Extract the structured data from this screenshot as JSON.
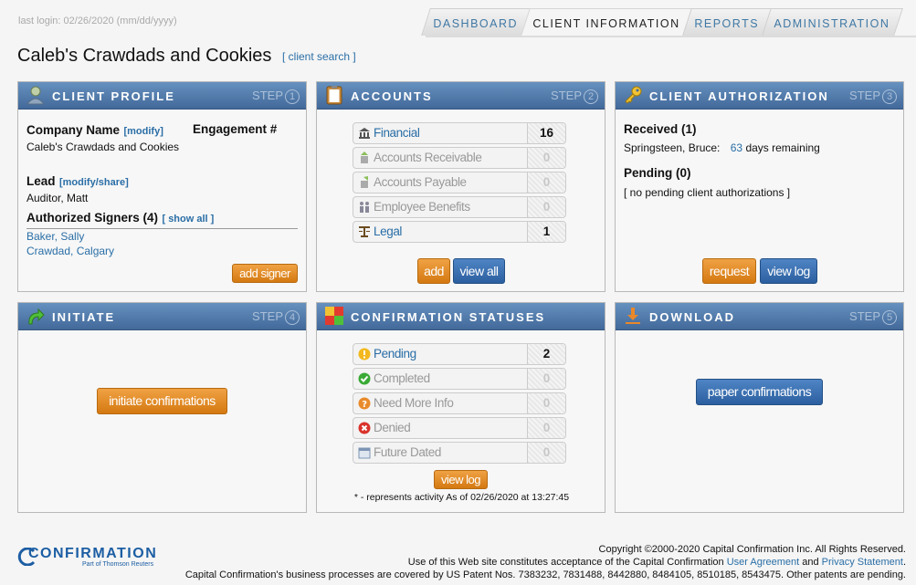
{
  "header": {
    "last_login": "last login: 02/26/2020 (mm/dd/yyyy)",
    "tabs": [
      "DASHBOARD",
      "CLIENT INFORMATION",
      "REPORTS",
      "ADMINISTRATION"
    ],
    "active_tab": "CLIENT INFORMATION"
  },
  "page": {
    "title": "Caleb's Crawdads and Cookies",
    "client_search": "[ client search ]"
  },
  "profile": {
    "title": "CLIENT PROFILE",
    "step_word": "STEP",
    "step_num": "1",
    "company_label": "Company Name",
    "company_link": "[modify]",
    "company_value": "Caleb's Crawdads and Cookies",
    "engagement_label": "Engagement #",
    "lead_label": "Lead",
    "lead_link": "[modify/share]",
    "lead_value": "Auditor, Matt",
    "signers_label": "Authorized Signers (4)",
    "signers_link": "[ show all ]",
    "signers": [
      "Baker, Sally",
      "Crawdad, Calgary"
    ],
    "add_signer": "add signer"
  },
  "accounts": {
    "title": "ACCOUNTS",
    "step_word": "STEP",
    "step_num": "2",
    "items": [
      {
        "label": "Financial",
        "count": "16",
        "active": true
      },
      {
        "label": "Accounts Receivable",
        "count": "0",
        "active": false
      },
      {
        "label": "Accounts Payable",
        "count": "0",
        "active": false
      },
      {
        "label": "Employee Benefits",
        "count": "0",
        "active": false
      },
      {
        "label": "Legal",
        "count": "1",
        "active": true
      }
    ],
    "add": "add",
    "view_all": "view all"
  },
  "authorization": {
    "title": "CLIENT AUTHORIZATION",
    "step_word": "STEP",
    "step_num": "3",
    "received_label": "Received (1)",
    "received_name": "Springsteen, Bruce:",
    "received_days": "63",
    "received_suffix": "days remaining",
    "pending_label": "Pending (0)",
    "pending_text": "[ no pending client authorizations ]",
    "request": "request",
    "view_log": "view log"
  },
  "initiate": {
    "title": "INITIATE",
    "step_word": "STEP",
    "step_num": "4",
    "button": "initiate confirmations"
  },
  "statuses": {
    "title": "CONFIRMATION STATUSES",
    "items": [
      {
        "label": "Pending",
        "count": "2",
        "active": true
      },
      {
        "label": "Completed",
        "count": "0",
        "active": false
      },
      {
        "label": "Need More Info",
        "count": "0",
        "active": false
      },
      {
        "label": "Denied",
        "count": "0",
        "active": false
      },
      {
        "label": "Future Dated",
        "count": "0",
        "active": false
      }
    ],
    "view_log": "view log",
    "note": "* - represents activity As of 02/26/2020 at 13:27:45"
  },
  "download": {
    "title": "DOWNLOAD",
    "step_word": "STEP",
    "step_num": "5",
    "button": "paper confirmations"
  },
  "footer": {
    "logo": "CONFIRMATION",
    "logo_sub": "Part of Thomson Reuters",
    "copyright": "Copyright ©2000-2020 Capital Confirmation Inc. All Rights Reserved.",
    "terms_prefix": "Use of this Web site constitutes acceptance of the Capital Confirmation",
    "user_agreement": "User Agreement",
    "and": "and",
    "privacy": "Privacy Statement",
    "period": ".",
    "patents": "Capital Confirmation's business processes are covered by US Patent Nos. 7383232, 7831488, 8442880, 8484105, 8510185, 8543475. Other patents are pending."
  }
}
